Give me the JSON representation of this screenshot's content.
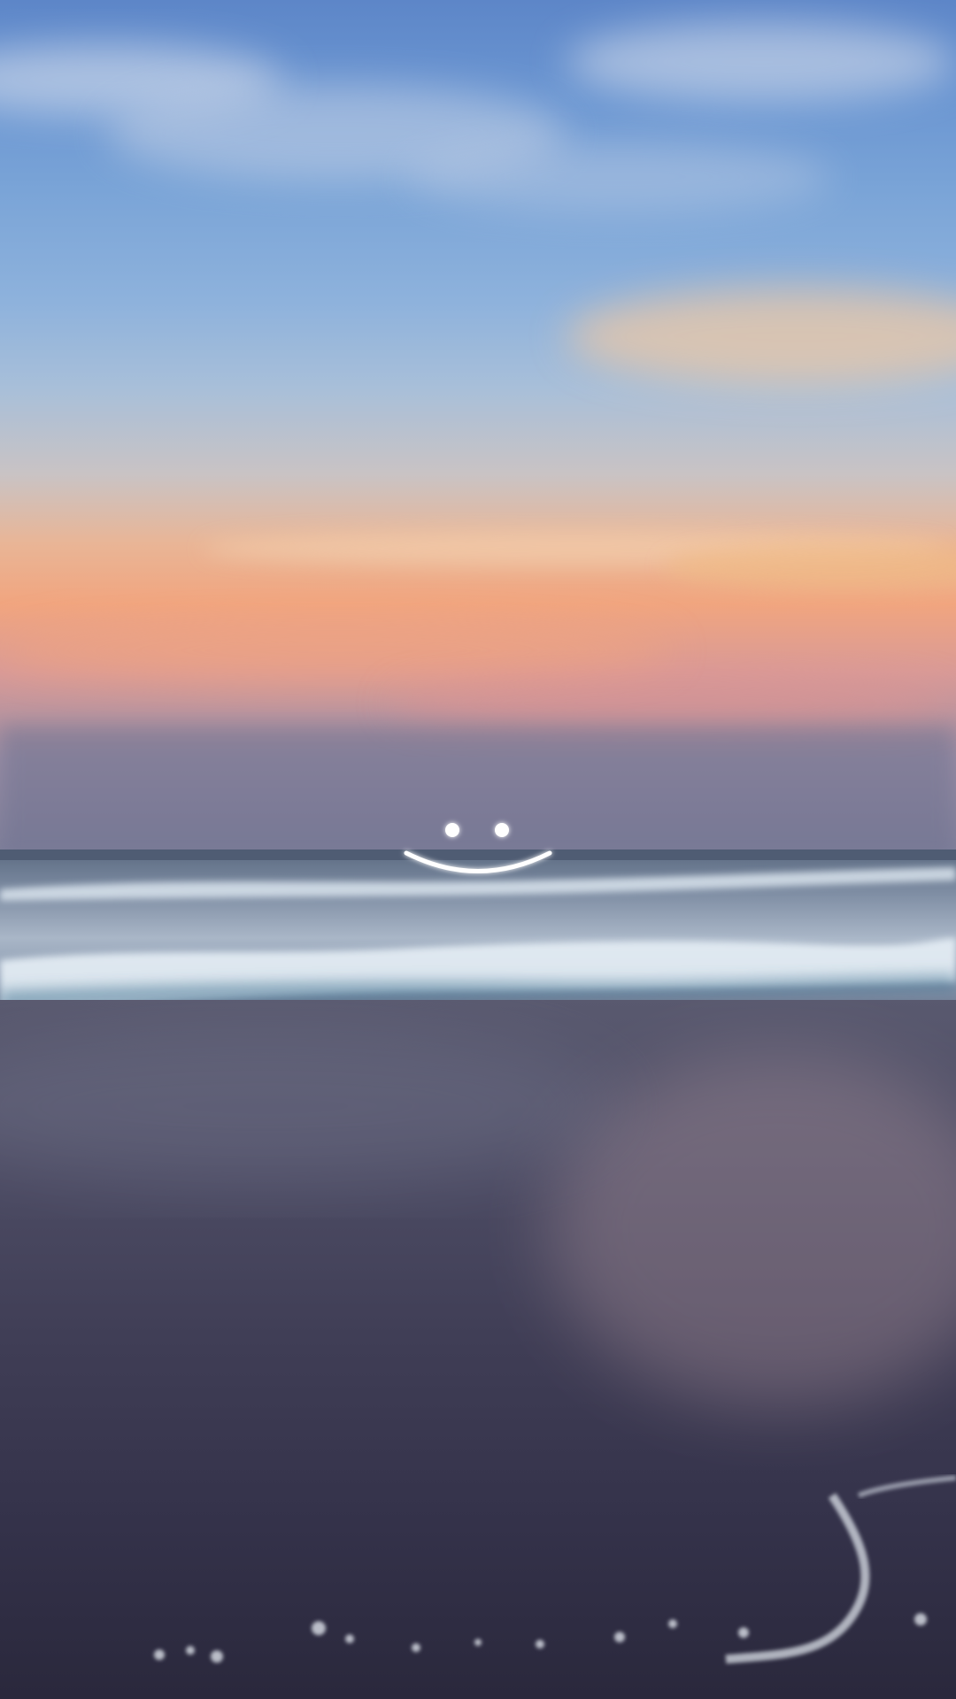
{
  "scene": {
    "sky_top_color": "#5d86c8",
    "sunset_glow_color": "#f1a57f",
    "sea_color": "#7f8ea4",
    "foam_color": "#dfe9f2",
    "sand_color": "#3f3d55"
  },
  "overlay": {
    "icon": "smiley-face-icon",
    "color": "#ffffff"
  }
}
